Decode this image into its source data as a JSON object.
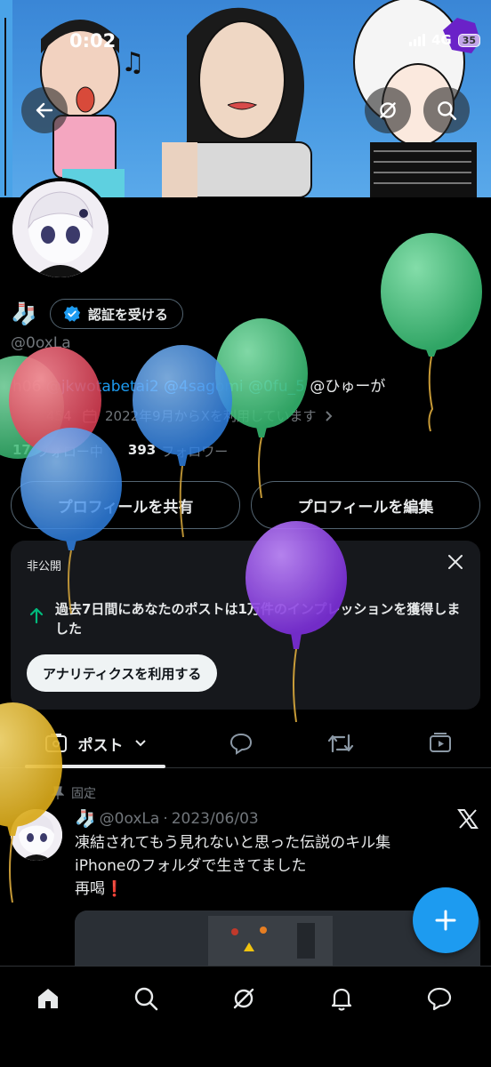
{
  "status_bar": {
    "time": "0:02",
    "network": "4G",
    "battery": "35"
  },
  "profile": {
    "verify_label": "認証を受ける",
    "handle": "@0oxLa",
    "bio_prefix": "h06",
    "bio_mentions": [
      "@jkwotabetai2",
      "@4sagomi",
      "@0fu_5"
    ],
    "bio_suffix": "@ひゅーが",
    "bio_lead": "454",
    "joined": "2022年9月からXを利用しています",
    "following_count": "17",
    "following_label": "フォロー中",
    "followers_count": "393",
    "followers_label": "フォロワー",
    "share_button": "プロフィールを共有",
    "edit_button": "プロフィールを編集"
  },
  "analytics_card": {
    "private_label": "非公開",
    "message": "過去7日間にあなたのポストは1万件のインプレッションを獲得しました",
    "cta": "アナリティクスを利用する"
  },
  "tabs": {
    "posts_label": "ポスト"
  },
  "pinned_post": {
    "pinned_label": "固定",
    "handle": "@0oxLa",
    "separator": "·",
    "date": "2023/06/03",
    "text_line1": "凍結されてもう見れないと思った伝説のキル集",
    "text_line2": "iPhoneのフォルダで生きてました",
    "text_line3": "再喝❗️"
  },
  "colors": {
    "accent": "#1d9bf0",
    "background": "#000000",
    "card": "#16181c",
    "muted": "#71767b"
  },
  "icons": [
    "back-arrow-icon",
    "grok-icon",
    "search-icon",
    "verified-badge-icon",
    "calendar-icon",
    "close-icon",
    "up-arrow-icon",
    "posts-icon",
    "reply-icon",
    "repost-icon",
    "media-icon",
    "pin-icon",
    "x-logo-icon",
    "plus-icon",
    "home-icon",
    "notifications-icon",
    "messages-icon"
  ]
}
